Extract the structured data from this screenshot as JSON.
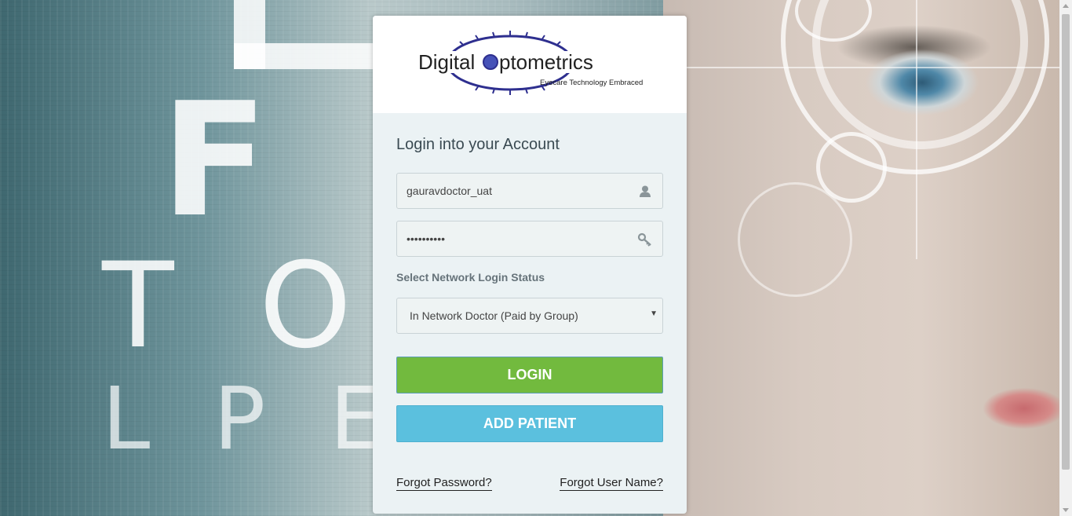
{
  "background": {
    "eye_chart_letters": [
      "F",
      "T",
      "O",
      "L",
      "P",
      "E"
    ]
  },
  "brand": {
    "name_part1": "Digital",
    "name_part2": "ptometrics",
    "tagline": "Eyecare Technology Embraced",
    "colors": {
      "primary": "#2e2f8f",
      "text": "#222222"
    }
  },
  "form": {
    "title": "Login into your Account",
    "username": {
      "value": "gauravdoctor_uat",
      "icon": "user-icon"
    },
    "password": {
      "value": "••••••••••",
      "icon": "key-icon"
    },
    "network_status_label": "Select Network Login Status",
    "network_status": {
      "selected": "In Network Doctor (Paid by Group)",
      "icon": "caret-down-icon"
    }
  },
  "buttons": {
    "login": "LOGIN",
    "add_patient": "ADD PATIENT",
    "colors": {
      "login": "#72ba3e",
      "add_patient": "#5bc0de"
    }
  },
  "links": {
    "forgot_password": "Forgot Password?",
    "forgot_username": "Forgot User Name?"
  }
}
